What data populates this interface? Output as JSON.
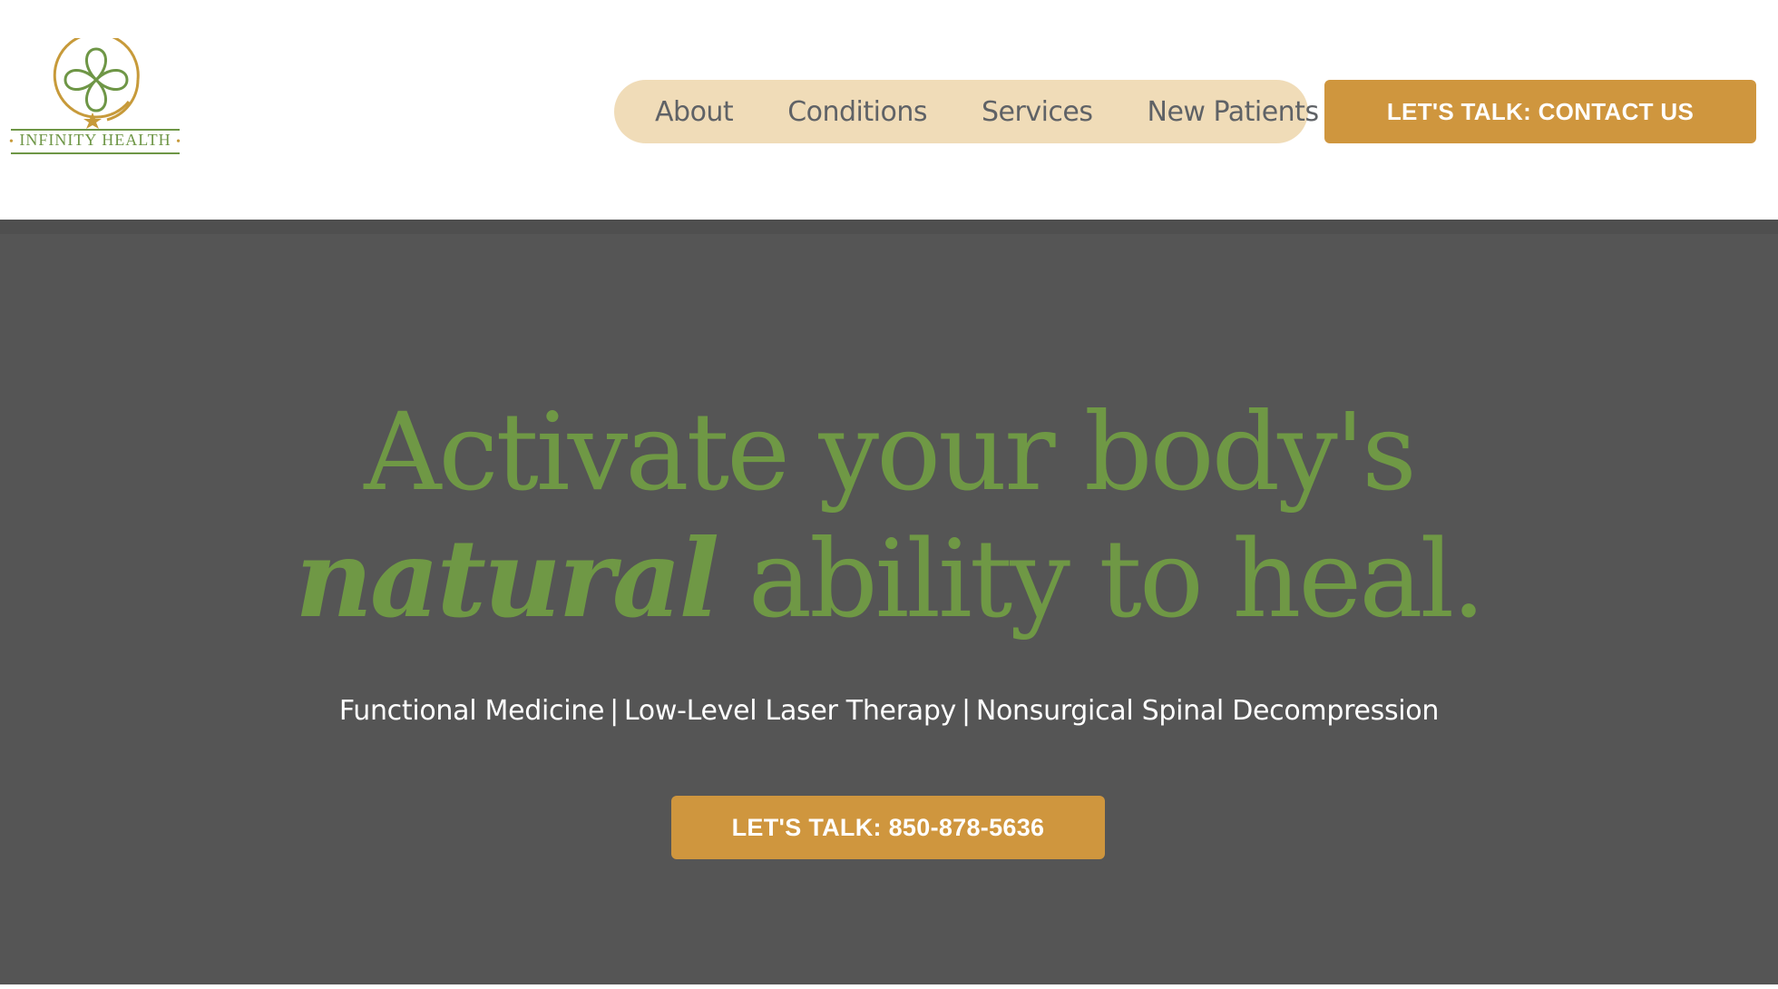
{
  "brand": {
    "name": "INFINITY HEALTH",
    "logo_icon": "infinity-clover-icon",
    "color_green": "#6f9845",
    "color_gold": "#cf963e"
  },
  "nav": {
    "items": [
      {
        "label": "About"
      },
      {
        "label": "Conditions"
      },
      {
        "label": "Services"
      },
      {
        "label": "New Patients"
      }
    ],
    "pill_color": "#f0dcb8"
  },
  "header_cta": {
    "label": "LET'S TALK: CONTACT US"
  },
  "hero": {
    "headline_line1": "Activate your body's",
    "headline_emphasis": "natural",
    "headline_line2_rest": " ability to heal.",
    "services": [
      "Functional Medicine",
      "Low-Level Laser Therapy",
      "Nonsurgical Spinal Decompression"
    ],
    "separator": "|",
    "cta_label": "LET'S TALK: 850-878-5636",
    "background": "#555555"
  }
}
